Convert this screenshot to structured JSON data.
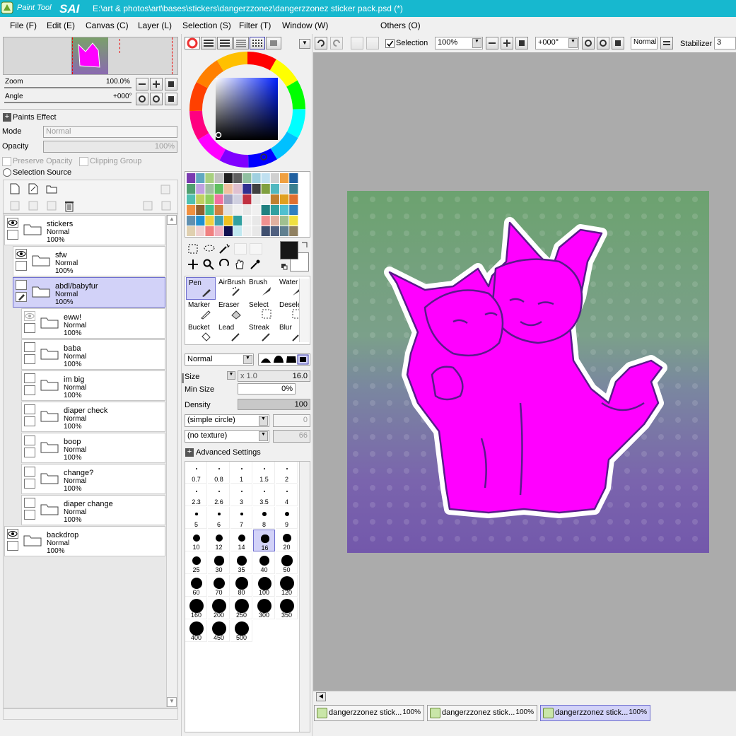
{
  "app": {
    "logo_small": "Paint Tool",
    "logo_big": "SAI",
    "title": "E:\\art & photos\\art\\bases\\stickers\\dangerzzonez\\dangerzzonez sticker pack.psd (*)"
  },
  "menu": [
    "File (F)",
    "Edit (E)",
    "Canvas (C)",
    "Layer (L)",
    "Selection (S)",
    "Filter (T)",
    "Window (W)",
    "Others (O)"
  ],
  "toolbar": {
    "selection_label": "Selection",
    "zoom": "100%",
    "angle": "+000°",
    "blend": "Normal",
    "stabilizer_label": "Stabilizer",
    "stabilizer": "3"
  },
  "navigator": {
    "zoom_label": "Zoom",
    "zoom_value": "100.0%",
    "angle_label": "Angle",
    "angle_value": "+000°"
  },
  "layers_panel": {
    "paints_effect": "Paints Effect",
    "mode_label": "Mode",
    "mode_value": "Normal",
    "opacity_label": "Opacity",
    "opacity_value": "100%",
    "preserve_opacity": "Preserve Opacity",
    "clipping_group": "Clipping Group",
    "selection_source": "Selection Source"
  },
  "layers": [
    {
      "name": "stickers",
      "mode": "Normal",
      "opacity": "100%"
    },
    {
      "name": "sfw",
      "mode": "Normal",
      "opacity": "100%"
    },
    {
      "name": "abdl/babyfur",
      "mode": "Normal",
      "opacity": "100%"
    },
    {
      "name": "eww!",
      "mode": "Normal",
      "opacity": "100%"
    },
    {
      "name": "baba",
      "mode": "Normal",
      "opacity": "100%"
    },
    {
      "name": "im big",
      "mode": "Normal",
      "opacity": "100%"
    },
    {
      "name": "diaper check",
      "mode": "Normal",
      "opacity": "100%"
    },
    {
      "name": "boop",
      "mode": "Normal",
      "opacity": "100%"
    },
    {
      "name": "change?",
      "mode": "Normal",
      "opacity": "100%"
    },
    {
      "name": "diaper change",
      "mode": "Normal",
      "opacity": "100%"
    },
    {
      "name": "backdrop",
      "mode": "Normal",
      "opacity": "100%"
    }
  ],
  "tools": [
    "Pen",
    "AirBrush",
    "Brush",
    "Water",
    "Marker",
    "Eraser",
    "Select",
    "Deselect",
    "Bucket",
    "Lead",
    "Streak",
    "Blur"
  ],
  "brush": {
    "blend": "Normal",
    "size_label": "Size",
    "size_mult": "x 1.0",
    "size": "16.0",
    "min_size_label": "Min Size",
    "min_size": "0%",
    "density_label": "Density",
    "density": "100",
    "shape": "(simple circle)",
    "shape_val": "0",
    "texture": "(no texture)",
    "texture_val": "66",
    "advanced": "Advanced Settings"
  },
  "brush_sizes": [
    "0.7",
    "0.8",
    "1",
    "1.5",
    "2",
    "2.3",
    "2.6",
    "3",
    "3.5",
    "4",
    "5",
    "6",
    "7",
    "8",
    "9",
    "10",
    "12",
    "14",
    "16",
    "20",
    "25",
    "30",
    "35",
    "40",
    "50",
    "60",
    "70",
    "80",
    "100",
    "120",
    "160",
    "200",
    "250",
    "300",
    "350",
    "400",
    "450",
    "500"
  ],
  "colors": {
    "accent": "#17b8cf",
    "sticker": "#ff00ff",
    "outline": "#5a1a8a",
    "bg_top": "#6fa36f",
    "bg_bottom": "#7a5ab0",
    "selected_layer": "#d2d2f8"
  },
  "tabs": [
    {
      "label": "dangerzzonez stick...",
      "pct": "100%"
    },
    {
      "label": "dangerzzonez stick...",
      "pct": "100%"
    },
    {
      "label": "dangerzzonez stick...",
      "pct": "100%"
    }
  ]
}
